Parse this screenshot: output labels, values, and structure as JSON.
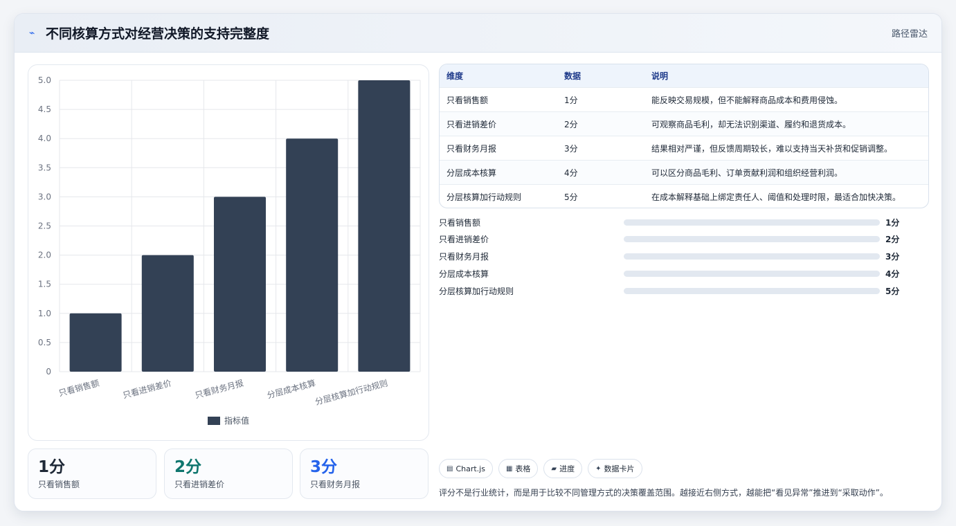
{
  "header": {
    "title": "不同核算方式对经营决策的支持完整度",
    "tag": "路径雷达",
    "icon": "pulse-icon"
  },
  "chart_data": {
    "type": "bar",
    "categories": [
      "只看销售额",
      "只看进销差价",
      "只看财务月报",
      "分层成本核算",
      "分层核算加行动规则"
    ],
    "series": [
      {
        "name": "指标值",
        "values": [
          1,
          2,
          3,
          4,
          5
        ]
      }
    ],
    "ylim": [
      0,
      5
    ],
    "yticks": [
      "0",
      "0.5",
      "1.0",
      "1.5",
      "2.0",
      "2.5",
      "3.0",
      "3.5",
      "4.0",
      "4.5",
      "5.0"
    ],
    "grid": true,
    "legend": "bottom",
    "bar_color": "#334155"
  },
  "table": {
    "headers": [
      "维度",
      "数据",
      "说明"
    ],
    "rows": [
      [
        "只看销售额",
        "1分",
        "能反映交易规模，但不能解释商品成本和费用侵蚀。"
      ],
      [
        "只看进销差价",
        "2分",
        "可观察商品毛利，却无法识别渠道、履约和退货成本。"
      ],
      [
        "只看财务月报",
        "3分",
        "结果相对严谨，但反馈周期较长，难以支持当天补货和促销调整。"
      ],
      [
        "分层成本核算",
        "4分",
        "可以区分商品毛利、订单贡献利润和组织经营利润。"
      ],
      [
        "分层核算加行动规则",
        "5分",
        "在成本解释基础上绑定责任人、阈值和处理时限，最适合加快决策。"
      ]
    ]
  },
  "progress": [
    {
      "label": "只看销售额",
      "value": 1,
      "max": 5,
      "text": "1分"
    },
    {
      "label": "只看进销差价",
      "value": 2,
      "max": 5,
      "text": "2分"
    },
    {
      "label": "只看财务月报",
      "value": 3,
      "max": 5,
      "text": "3分"
    },
    {
      "label": "分层成本核算",
      "value": 4,
      "max": 5,
      "text": "4分"
    },
    {
      "label": "分层核算加行动规则",
      "value": 5,
      "max": 5,
      "text": "5分"
    }
  ],
  "stats": [
    {
      "num": "1分",
      "label": "只看销售额",
      "color": "#1f2937"
    },
    {
      "num": "2分",
      "label": "只看进销差价",
      "color": "#0f766e"
    },
    {
      "num": "3分",
      "label": "只看财务月报",
      "color": "#2563eb"
    }
  ],
  "chips": [
    {
      "icon": "chart-icon",
      "glyph": "▤",
      "label": "Chart.js"
    },
    {
      "icon": "table-icon",
      "glyph": "▦",
      "label": "表格"
    },
    {
      "icon": "progress-icon",
      "glyph": "▰",
      "label": "进度"
    },
    {
      "icon": "sparkle-icon",
      "glyph": "✦",
      "label": "数据卡片"
    }
  ],
  "note": "评分不是行业统计，而是用于比较不同管理方式的决策覆盖范围。越接近右侧方式，越能把“看见异常”推进到“采取动作”。"
}
